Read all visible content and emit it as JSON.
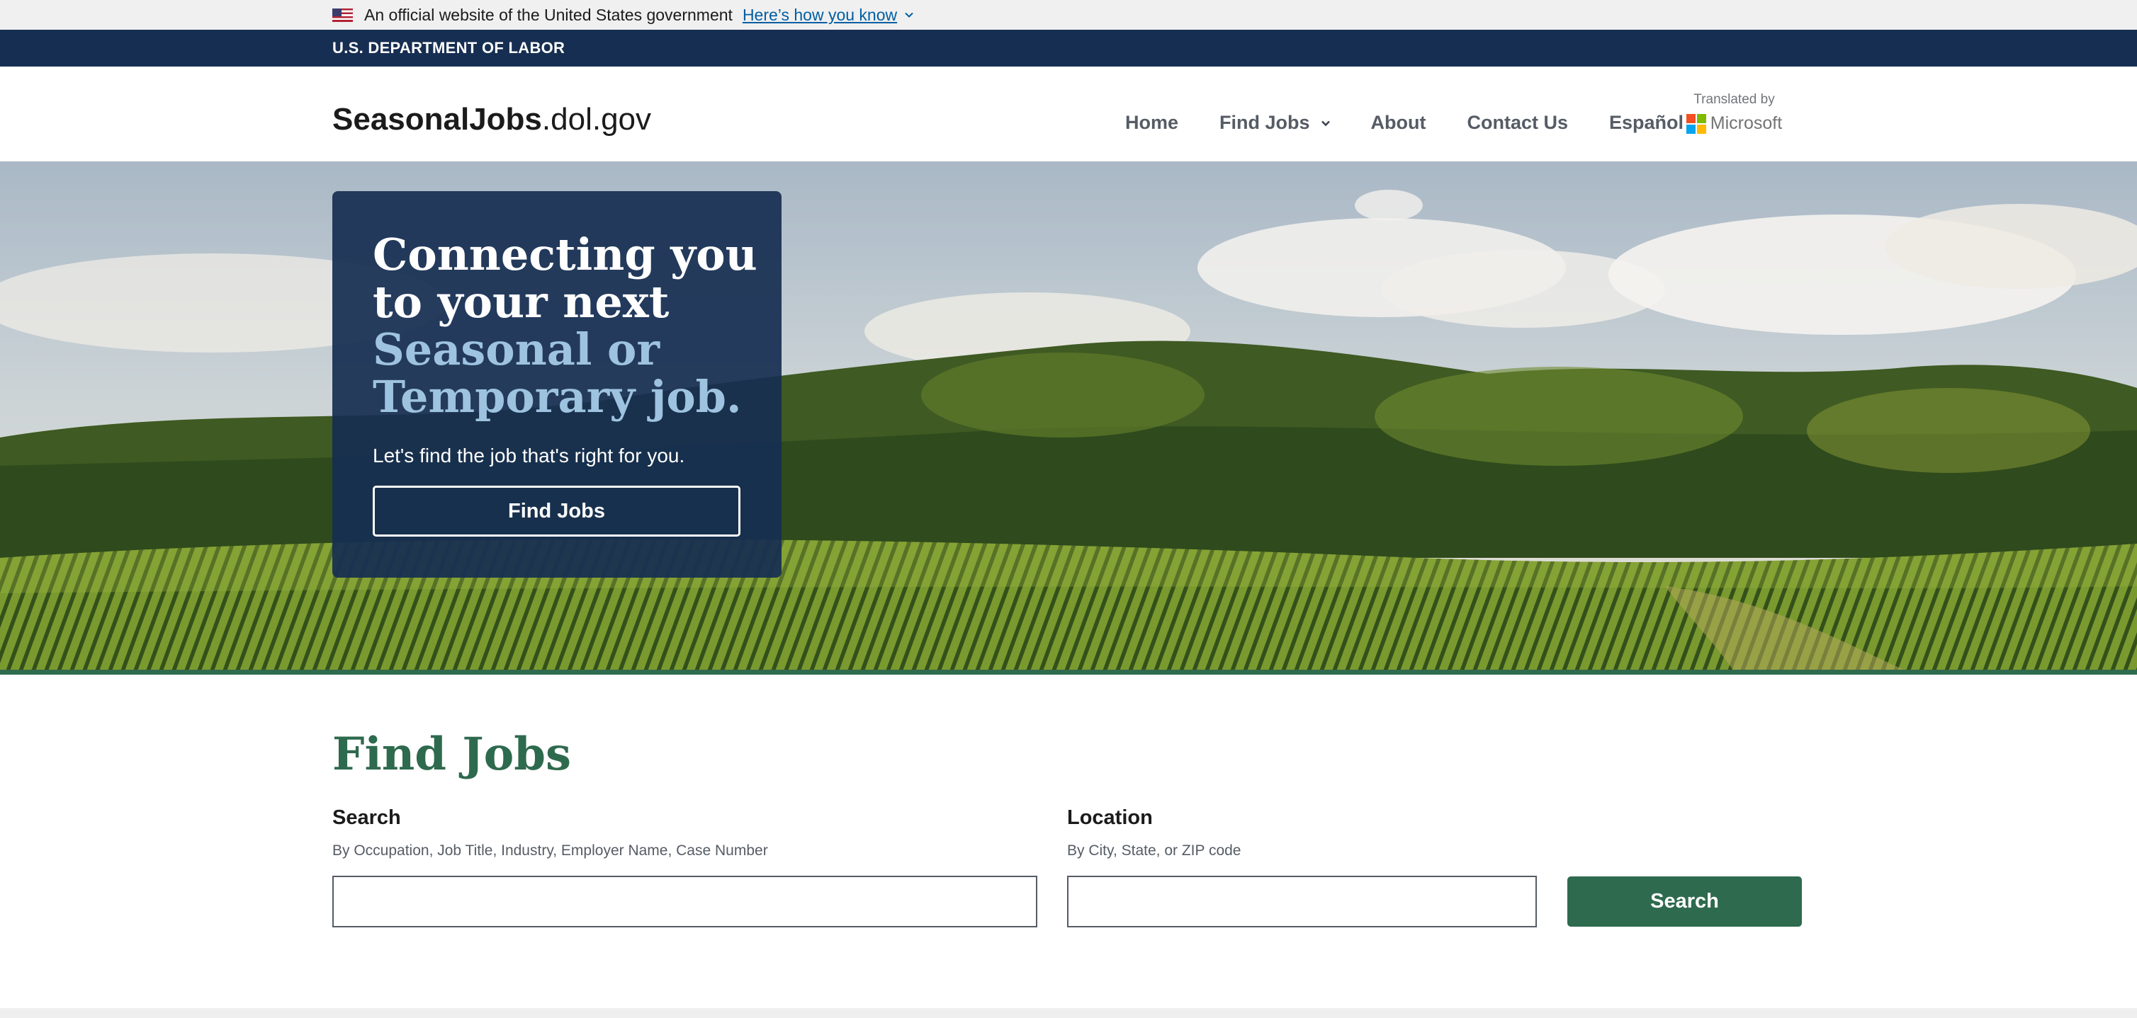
{
  "gov_banner": {
    "text": "An official website of the United States government",
    "link": "Here’s how you know"
  },
  "agency": {
    "name": "U.S. DEPARTMENT OF LABOR"
  },
  "header": {
    "logo_bold": "SeasonalJobs",
    "logo_rest": ".dol.gov",
    "nav": {
      "home": "Home",
      "find_jobs": "Find Jobs",
      "about": "About",
      "contact": "Contact Us",
      "spanish": "Español"
    },
    "translated_by": "Translated by",
    "translator": "Microsoft"
  },
  "hero": {
    "title_line1": "Connecting you to your next",
    "title_accent": "Seasonal or Temporary job.",
    "subtitle": "Let's find the job that's right for you.",
    "button": "Find Jobs"
  },
  "find_jobs": {
    "title": "Find Jobs",
    "search_label": "Search",
    "search_hint": "By Occupation, Job Title, Industry, Employer Name, Case Number",
    "search_value": "",
    "location_label": "Location",
    "location_hint": "By City, State, or ZIP code",
    "location_value": "",
    "button": "Search"
  },
  "colors": {
    "agency_bar": "#162e51",
    "primary_green": "#2e6a4e",
    "hero_accent": "#9ec3e0",
    "link_blue": "#005ea2"
  }
}
